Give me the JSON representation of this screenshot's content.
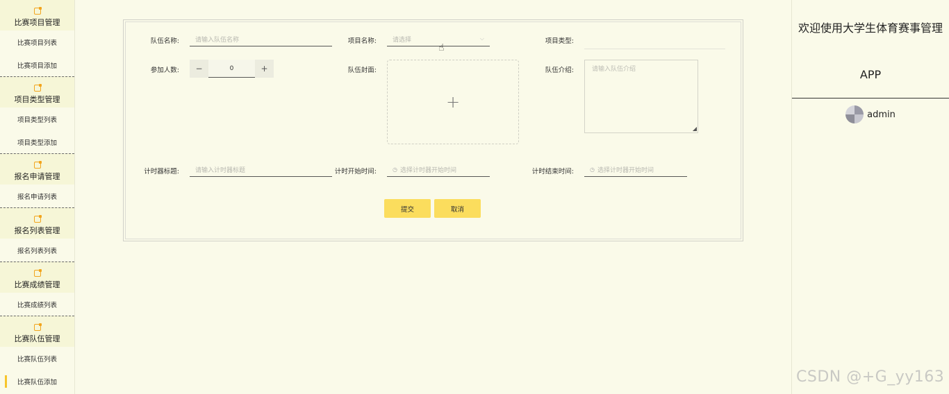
{
  "sidebar": {
    "groups": [
      {
        "title": "比赛项目管理",
        "items": [
          "比赛项目列表",
          "比赛项目添加"
        ]
      },
      {
        "title": "项目类型管理",
        "items": [
          "项目类型列表",
          "项目类型添加"
        ]
      },
      {
        "title": "报名申请管理",
        "items": [
          "报名申请列表"
        ]
      },
      {
        "title": "报名列表管理",
        "items": [
          "报名列表列表"
        ]
      },
      {
        "title": "比赛成绩管理",
        "items": [
          "比赛成绩列表"
        ]
      },
      {
        "title": "比赛队伍管理",
        "items": [
          "比赛队伍列表",
          "比赛队伍添加"
        ]
      }
    ]
  },
  "header": {
    "welcome_line1": "欢迎使用大学生体育赛事管理",
    "welcome_line2": "APP",
    "username": "admin"
  },
  "form": {
    "team_name_label": "队伍名称:",
    "team_name_placeholder": "请输入队伍名称",
    "project_name_label": "项目名称:",
    "project_name_placeholder": "请选择",
    "project_type_label": "项目类型:",
    "participants_label": "参加人数:",
    "participants_value": "0",
    "cover_label": "队伍封面:",
    "intro_label": "队伍介绍:",
    "intro_placeholder": "请输入队伍介绍",
    "timer_title_label": "计时器标题:",
    "timer_title_placeholder": "请输入计时器标题",
    "timer_start_label": "计时开始时间:",
    "timer_start_placeholder": "选择计时器开始时间",
    "timer_end_label": "计时结束时间:",
    "timer_end_placeholder": "选择计时器开始时间",
    "submit_label": "提交",
    "cancel_label": "取消"
  },
  "watermark": "CSDN @+G_yy163",
  "colors": {
    "accent": "#fbdd5d",
    "background": "#fafae9",
    "icon": "#f2a41c"
  }
}
